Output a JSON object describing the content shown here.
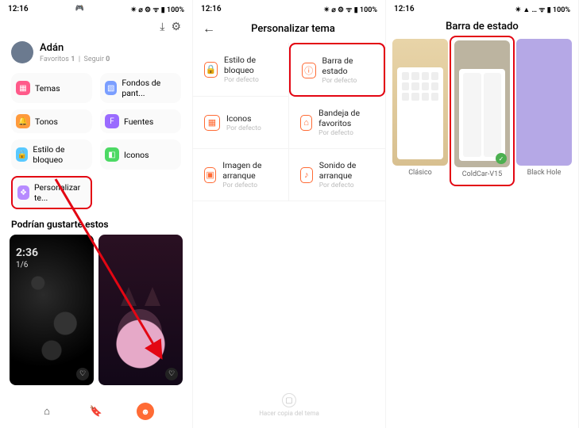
{
  "status": {
    "time": "12:16",
    "icons": "✴ ⌀ ⚙ ᯤ ▮ 100%",
    "icons2": "✴ ⌀ ⚙ ᯤ ▮ 100%",
    "icons3": "✴ ▲ … ᯤ ▮ 100%",
    "gamepad": "🎮"
  },
  "s1": {
    "download": "⤓",
    "settings": "⚙",
    "name": "Adán",
    "fav_label": "Favoritos",
    "fav_count": "1",
    "follow_label": "Seguir",
    "follow_count": "0",
    "tiles": [
      {
        "label": "Temas",
        "color": "#ff5a8a",
        "icon": "▦"
      },
      {
        "label": "Fondos de pant...",
        "color": "#7a9eff",
        "icon": "▧"
      },
      {
        "label": "Tonos",
        "color": "#ff9a3c",
        "icon": "🔔"
      },
      {
        "label": "Fuentes",
        "color": "#9a6bff",
        "icon": "F"
      },
      {
        "label": "Estilo de bloqueo",
        "color": "#59c9ff",
        "icon": "🔒"
      },
      {
        "label": "Iconos",
        "color": "#4cd964",
        "icon": "◧"
      },
      {
        "label": "Personalizar te...",
        "color": "#b78bff",
        "icon": "❖"
      }
    ],
    "section": "Podrían gustarte estos",
    "clock": "2:36",
    "date": "1/6",
    "nav": {
      "home": "⌂",
      "bookmark": "🔖",
      "profile": "☻"
    }
  },
  "s2": {
    "back": "←",
    "title": "Personalizar tema",
    "options": [
      {
        "label": "Estilo de bloqueo",
        "sub": "Por defecto",
        "icon": "🔒"
      },
      {
        "label": "Barra de estado",
        "sub": "Por defecto",
        "icon": "ⓘ",
        "hl": true
      },
      {
        "label": "Iconos",
        "sub": "Por defecto",
        "icon": "▦"
      },
      {
        "label": "Bandeja de favoritos",
        "sub": "Por defecto",
        "icon": "⌂"
      },
      {
        "label": "Imagen de arranque",
        "sub": "Por defecto",
        "icon": "▣"
      },
      {
        "label": "Sonido de arranque",
        "sub": "Por defecto",
        "icon": "♪"
      }
    ],
    "copy": "Hacer copia del tema",
    "copyicon": "▢"
  },
  "s3": {
    "title": "Barra de estado",
    "themes": [
      {
        "label": "Clásico"
      },
      {
        "label": "ColdCar-V15",
        "sel": true
      },
      {
        "label": "Black Hole"
      }
    ]
  },
  "colors": {
    "accent": "#ff6b35",
    "highlight": "#e30613"
  }
}
